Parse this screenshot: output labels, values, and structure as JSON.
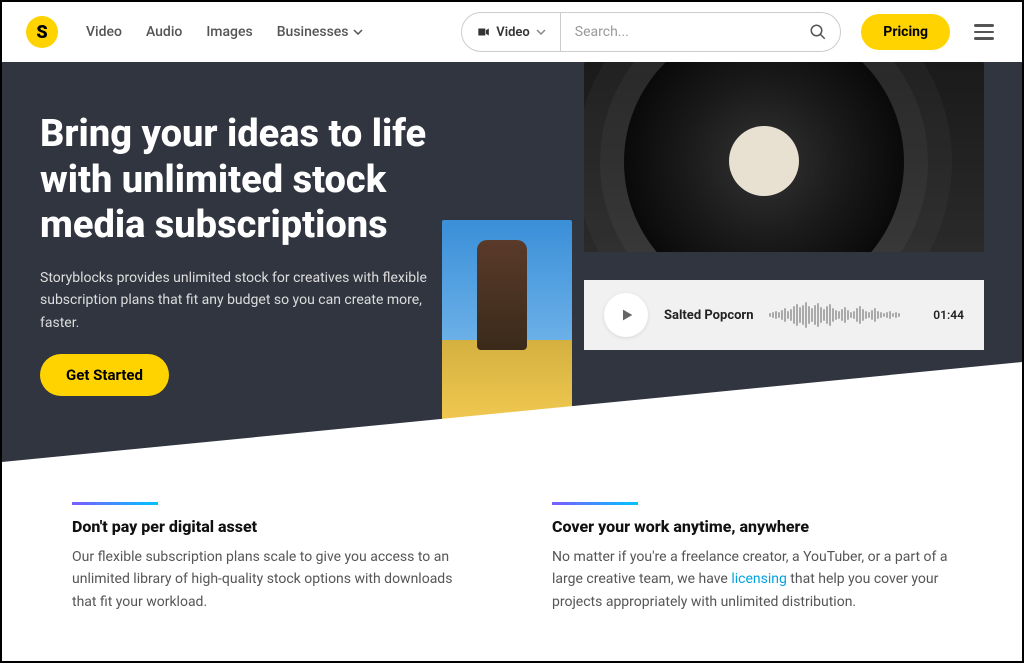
{
  "header": {
    "logo_text": "S",
    "nav": [
      "Video",
      "Audio",
      "Images",
      "Businesses"
    ],
    "search_category": "Video",
    "search_placeholder": "Search...",
    "pricing_label": "Pricing"
  },
  "hero": {
    "title": "Bring your ideas to life with unlimited stock media subscriptions",
    "subtitle": "Storyblocks provides unlimited stock for creatives with flexible subscription plans that fit any budget so you can create more, faster.",
    "cta_label": "Get Started"
  },
  "audio": {
    "title": "Salted Popcorn",
    "duration": "01:44"
  },
  "features": [
    {
      "heading": "Don't pay per digital asset",
      "body": "Our flexible subscription plans scale to give you access to an unlimited library of high-quality stock options with downloads that fit your workload."
    },
    {
      "heading": "Cover your work anytime, anywhere",
      "body_before": "No matter if you're a freelance creator, a YouTuber, or a part of a large creative team, we have ",
      "link": "licensing",
      "body_after": " that help you cover your projects appropriately with unlimited distribution."
    }
  ]
}
